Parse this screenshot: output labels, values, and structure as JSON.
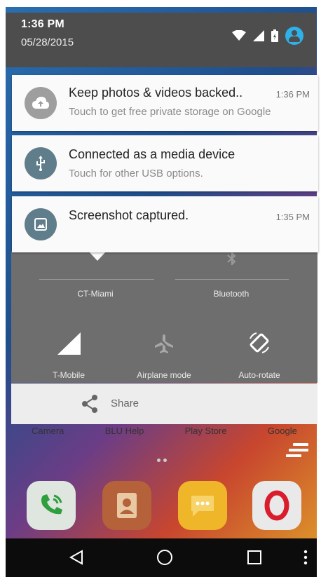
{
  "status_bar": {
    "time": "1:36 PM",
    "date": "05/28/2015",
    "icons": [
      "wifi-icon",
      "cell-signal-icon",
      "battery-icon",
      "account-icon"
    ]
  },
  "notifications": [
    {
      "icon": "cloud-upload-icon",
      "title": "Keep photos & videos backed..",
      "subtitle": "Touch to get free private storage on Google",
      "time": "1:36 PM"
    },
    {
      "icon": "usb-icon",
      "title": "Connected as a media device",
      "subtitle": "Touch for other USB options.",
      "time": ""
    },
    {
      "icon": "image-icon",
      "title": "Screenshot captured.",
      "subtitle": "",
      "time": "1:35 PM"
    }
  ],
  "quick_settings": {
    "wifi_label": "CT-Miami",
    "bluetooth_label": "Bluetooth",
    "cell_label": "T-Mobile",
    "airplane_label": "Airplane mode",
    "rotate_label": "Auto-rotate"
  },
  "share": {
    "label": "Share"
  },
  "home": {
    "app_labels": [
      "Camera",
      "BLU Help",
      "Play Store",
      "Google"
    ],
    "dock": [
      "phone-icon",
      "contacts-icon",
      "messaging-icon",
      "opera-icon"
    ]
  },
  "colors": {
    "status_bg": "#4d4d4d",
    "accent": "#2db1e8",
    "notif_icon_bg": "#607d8b",
    "quick_settings_bg": "#6e6e6e"
  }
}
